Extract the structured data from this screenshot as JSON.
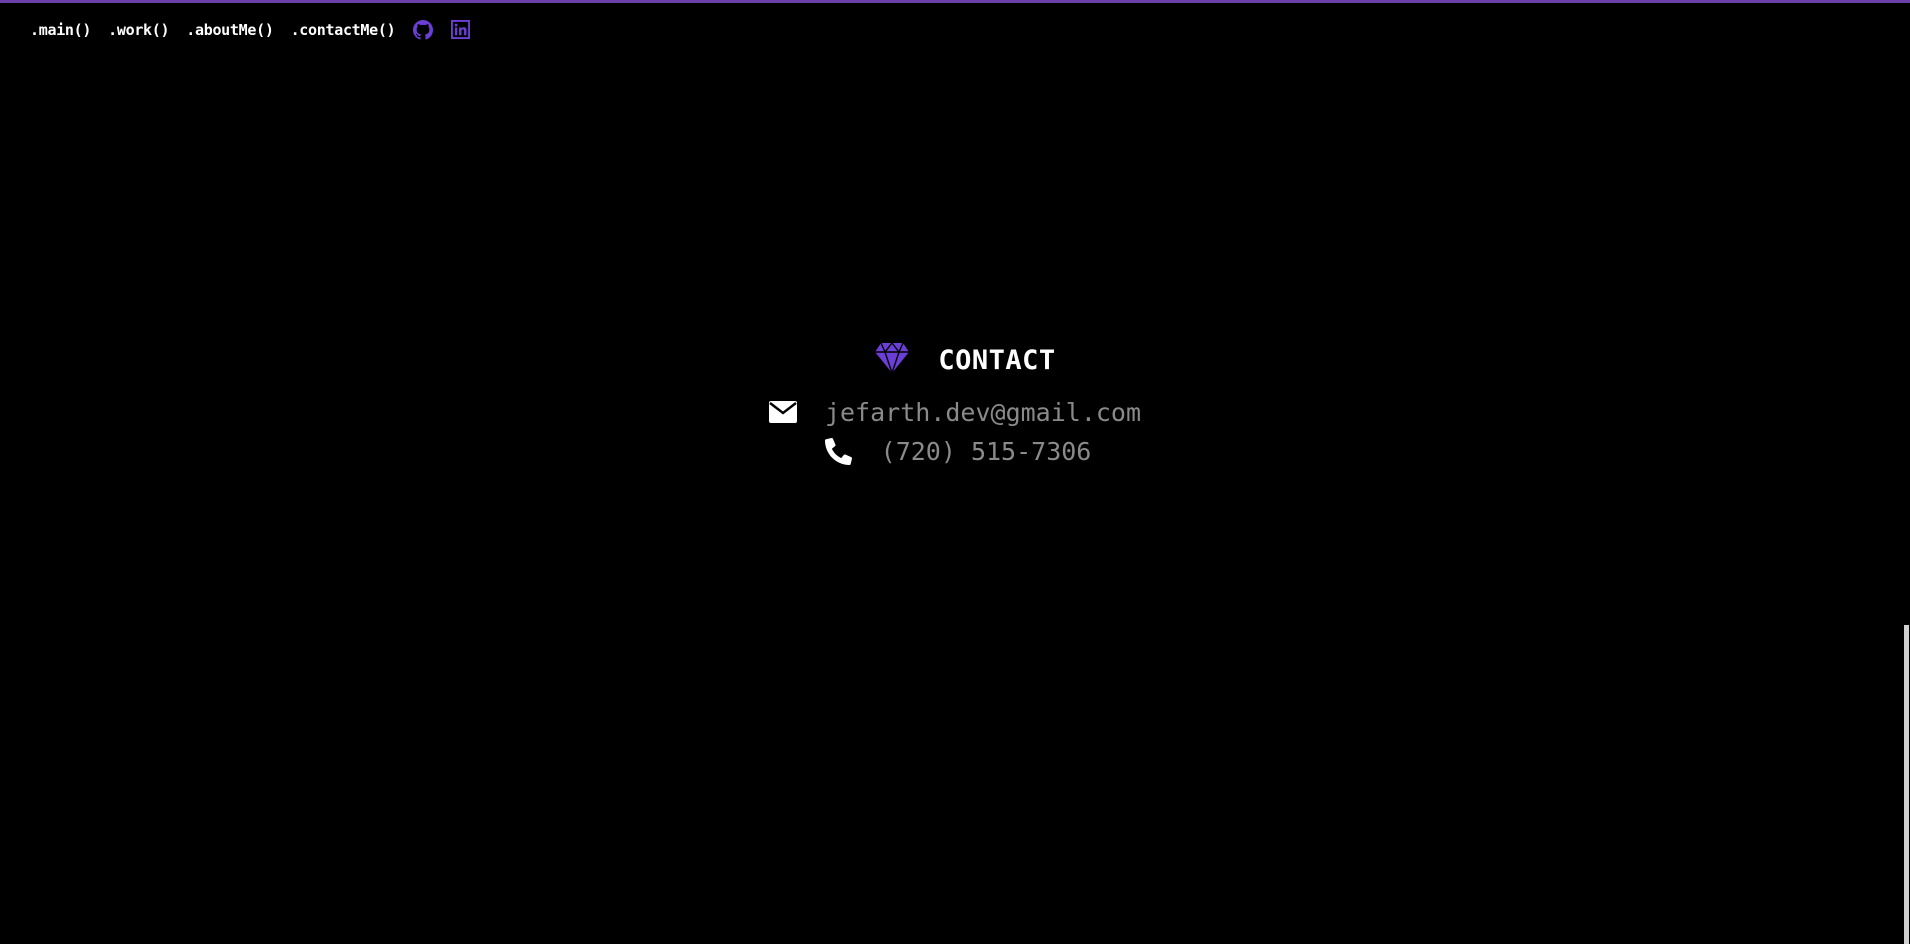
{
  "nav": {
    "items": [
      {
        "label": ".main()"
      },
      {
        "label": ".work()"
      },
      {
        "label": ".aboutMe()"
      },
      {
        "label": ".contactMe()"
      }
    ],
    "social": [
      {
        "icon": "github-icon"
      },
      {
        "icon": "linkedin-icon"
      }
    ]
  },
  "contact": {
    "title": "CONTACT",
    "title_icon": "diamond-icon",
    "email": "jefarth.dev@gmail.com",
    "email_icon": "envelope-icon",
    "phone": "(720) 515-7306",
    "phone_icon": "phone-icon"
  },
  "colors": {
    "background": "#000000",
    "accent": "#6b3fd6",
    "text": "#ffffff",
    "muted": "#8a8a8a",
    "top_border": "#6c3fa8"
  }
}
